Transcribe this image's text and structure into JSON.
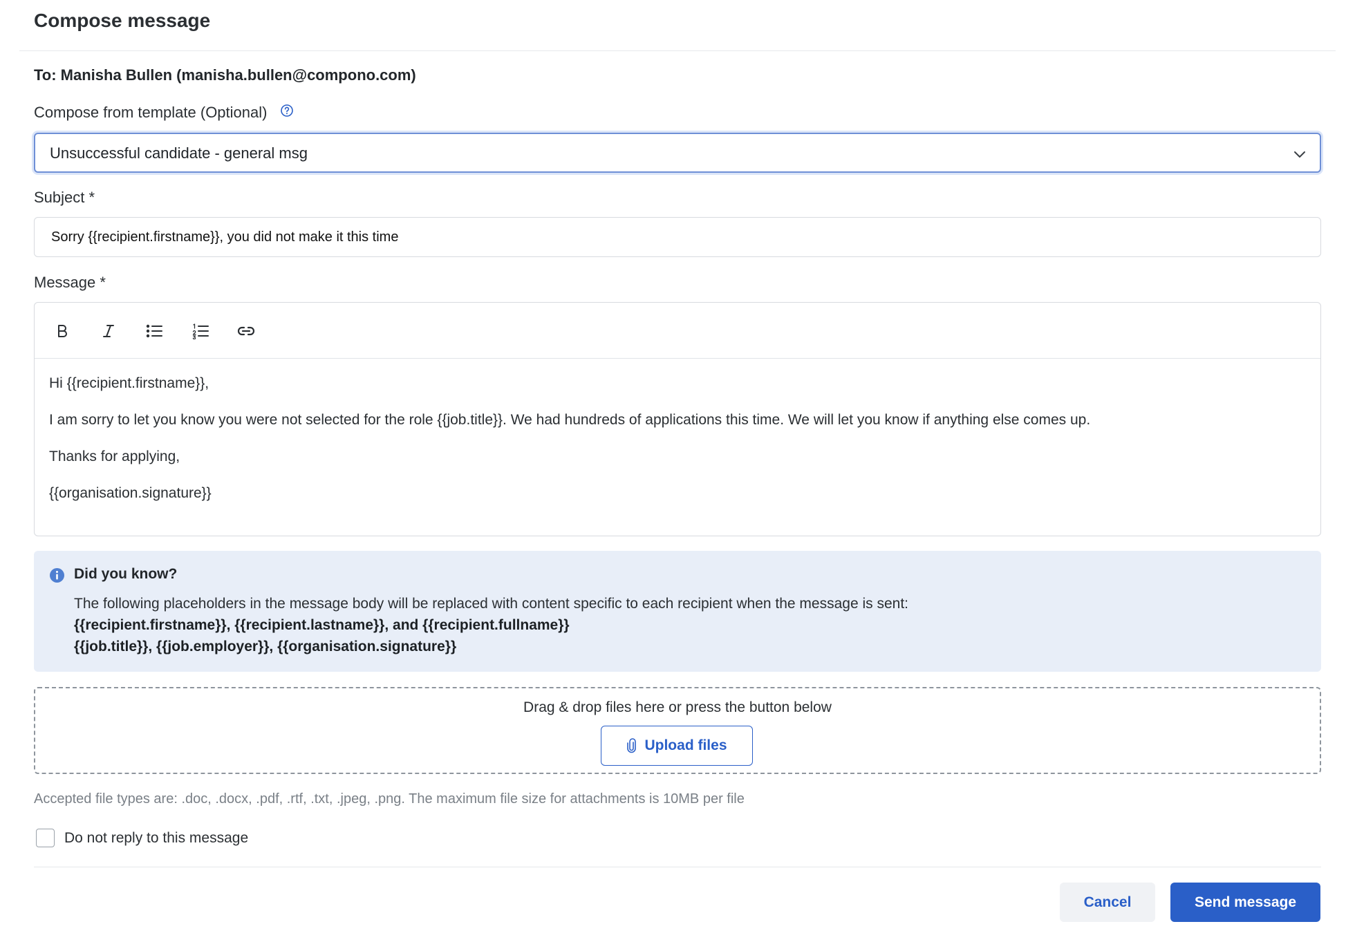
{
  "dialog": {
    "title": "Compose message",
    "to": "To: Manisha Bullen (manisha.bullen@compono.com)"
  },
  "template": {
    "label": "Compose from template (Optional)",
    "selected": "Unsuccessful candidate - general msg"
  },
  "subject": {
    "label": "Subject *",
    "value": "Sorry {{recipient.firstname}}, you did not make it this time"
  },
  "message": {
    "label": "Message *",
    "toolbar": [
      "bold-icon",
      "italic-icon",
      "bullet-list-icon",
      "numbered-list-icon",
      "link-icon"
    ],
    "paragraphs": [
      "Hi {{recipient.firstname}},",
      "I am sorry to let you know you were not selected for the role {{job.title}}. We had hundreds of applications this time. We will let you know if anything else comes up.",
      "Thanks for applying,",
      "{{organisation.signature}}"
    ]
  },
  "info": {
    "title": "Did you know?",
    "text": "The following placeholders in the message body will be replaced with content specific to each recipient when the message is sent:",
    "line1": "{{recipient.firstname}}, {{recipient.lastname}}, and {{recipient.fullname}}",
    "line2": "{{job.title}}, {{job.employer}}, {{organisation.signature}}"
  },
  "attachments": {
    "dropzone_text": "Drag & drop files here or press the button below",
    "upload_label": "Upload files",
    "accepted": "Accepted file types are: .doc, .docx, .pdf, .rtf, .txt, .jpeg, .png. The maximum file size for attachments is 10MB per file"
  },
  "no_reply": {
    "label": "Do not reply to this message",
    "checked": false
  },
  "footer": {
    "cancel": "Cancel",
    "send": "Send message"
  },
  "colors": {
    "primary": "#2a5fc8",
    "info_bg": "#e8eef8"
  }
}
